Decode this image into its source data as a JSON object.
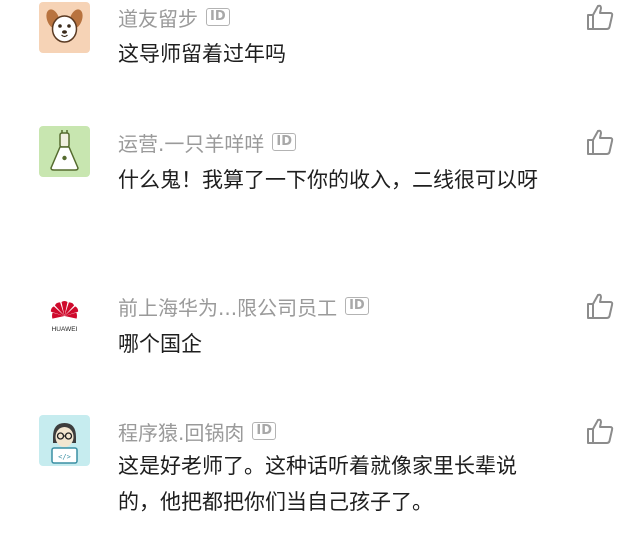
{
  "comments": [
    {
      "author": "道友留步",
      "badge": "ID",
      "text": "这导师留着过年吗",
      "avatar": "dog-avatar-icon"
    },
    {
      "author": "运营.一只羊咩咩",
      "badge": "ID",
      "text": "什么鬼！我算了一下你的收入，二线很可以呀",
      "avatar": "bottle-avatar-icon"
    },
    {
      "author": "前上海华为...限公司员工",
      "badge": "ID",
      "text": "哪个国企",
      "avatar": "huawei-logo-icon",
      "logo_text": "HUAWEI"
    },
    {
      "author": "程序猿.回锅肉",
      "badge": "ID",
      "text": "这是好老师了。这种话听着就像家里长辈说的，他把都把你们当自己孩子了。",
      "avatar": "programmer-avatar-icon"
    }
  ],
  "colors": {
    "author": "#9a9a9a",
    "text": "#1e1e1e",
    "like_icon": "#8c8c8c",
    "huawei_red": "#cf0a2c"
  }
}
